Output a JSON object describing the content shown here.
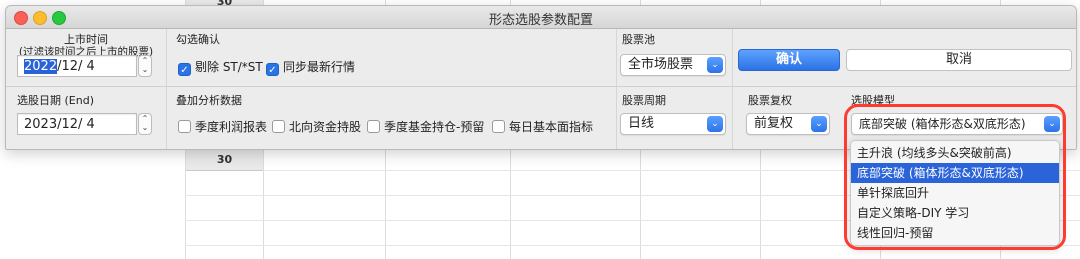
{
  "background": {
    "cell_top": "30",
    "cell_bottom": "30"
  },
  "window": {
    "title": "形态选股参数配置"
  },
  "listing_date": {
    "label_line1": "上市时间",
    "label_line2": "(过滤该时间之后上市的股票)",
    "year": "2022",
    "rest": "/12/  4"
  },
  "select_date": {
    "label": "选股日期 (End)",
    "value": "2023/12/  4"
  },
  "confirm_section": {
    "label": "勾选确认",
    "options": [
      {
        "label": "剔除 ST/*ST",
        "checked": true
      },
      {
        "label": "同步最新行情",
        "checked": true
      }
    ]
  },
  "overlay_section": {
    "label": "叠加分析数据",
    "options": [
      {
        "label": "季度利润报表",
        "checked": false
      },
      {
        "label": "北向资金持股",
        "checked": false
      },
      {
        "label": "季度基金持仓-预留",
        "checked": false
      },
      {
        "label": "每日基本面指标",
        "checked": false
      }
    ]
  },
  "stock_pool": {
    "label": "股票池",
    "value": "全市场股票"
  },
  "period": {
    "label": "股票周期",
    "value": "日线"
  },
  "adjust": {
    "label": "股票复权",
    "value": "前复权"
  },
  "model": {
    "label": "选股模型",
    "value": "底部突破 (箱体形态&双底形态)",
    "options": [
      "主升浪 (均线多头&突破前高)",
      "底部突破 (箱体形态&双底形态)",
      "单针探底回升",
      "自定义策略-DIY 学习",
      "线性回归-预留"
    ],
    "selected_index": 1
  },
  "buttons": {
    "confirm": "确认",
    "cancel": "取消"
  },
  "colors": {
    "accent": "#2b63d9",
    "highlight": "#ff3b30"
  }
}
